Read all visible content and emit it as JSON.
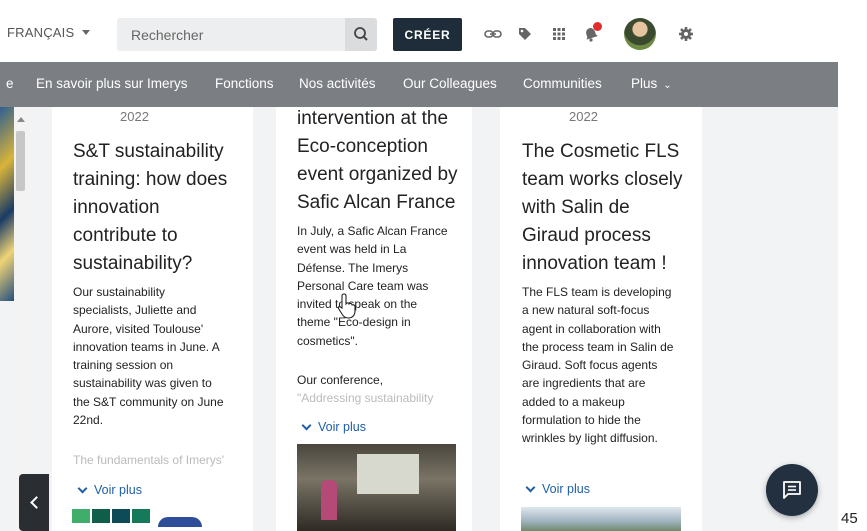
{
  "header": {
    "language": "FRANÇAIS",
    "search_placeholder": "Rechercher",
    "create_label": "CRÉER"
  },
  "nav": {
    "items": [
      {
        "label": "e"
      },
      {
        "label": "En savoir plus sur Imerys"
      },
      {
        "label": "Fonctions"
      },
      {
        "label": "Nos activités"
      },
      {
        "label": "Our Colleagues"
      },
      {
        "label": "Communities"
      },
      {
        "label": "Plus"
      }
    ]
  },
  "cards": [
    {
      "year": "2022",
      "title": [
        "S&T sustainability",
        "training: how does",
        "innovation",
        "contribute to",
        "sustainability?"
      ],
      "body": [
        "Our sustainability",
        "specialists, Juliette and",
        "Aurore, visited Toulouse'",
        "innovation teams in June.  A",
        "training session on",
        "sustainability was given to",
        "the S&T community on June",
        "22nd."
      ],
      "faded": "The fundamentals of Imerys'",
      "more": "Voir plus"
    },
    {
      "year": "",
      "title": [
        "intervention at the",
        "Eco-conception",
        "event organized by",
        "Safic Alcan France"
      ],
      "body": [
        "In July, a Safic Alcan France",
        "event was held in La",
        "Défense. The Imerys",
        "Personal Care team was",
        "invited to speak on the",
        "theme \"Eco-design in",
        "cosmetics\"."
      ],
      "body2": "Our conference,",
      "faded": "\"Addressing sustainability",
      "more": "Voir plus"
    },
    {
      "year": "2022",
      "title": [
        "The Cosmetic FLS",
        "team works closely",
        "with Salin de",
        "Giraud process",
        "innovation team !"
      ],
      "body": [
        "The FLS team is developing",
        "a new natural soft-focus",
        "agent in collaboration with",
        "the process team in Salin de",
        "Giraud. Soft focus agents",
        "are ingredients that are",
        "added to a makeup",
        "formulation to hide the",
        "wrinkles by light diffusion."
      ],
      "more": "Voir plus"
    }
  ],
  "corner_number": "45",
  "colors": {
    "nav_bg": "#7b7f84",
    "create_bg": "#1f2d3a",
    "link": "#1f5fa8",
    "content_bg": "#f1f3f4",
    "notification": "#e22d2d"
  },
  "icons": [
    "chevron-down-icon",
    "search-icon",
    "link-icon",
    "tag-icon",
    "apps-grid-icon",
    "bell-icon",
    "avatar",
    "gear-icon",
    "chevron-left-icon",
    "chat-icon",
    "hand-cursor-icon"
  ]
}
